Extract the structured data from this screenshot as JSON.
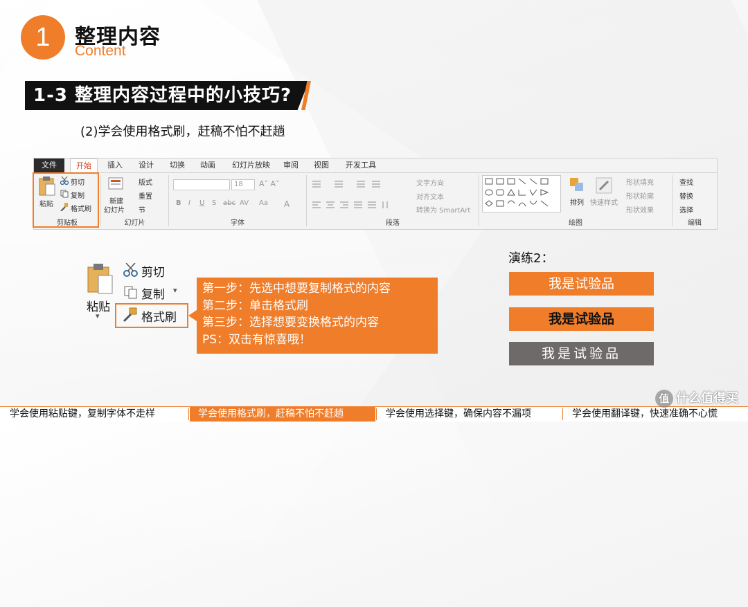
{
  "header": {
    "number": "1",
    "title": "整理内容",
    "subtitle": "Content"
  },
  "section": {
    "title": "1-3  整理内容过程中的小技巧?",
    "subheading": "(2)学会使用格式刷，赶稿不怕不赶趟"
  },
  "ribbon": {
    "tabs": [
      "文件",
      "开始",
      "插入",
      "设计",
      "切换",
      "动画",
      "幻灯片放映",
      "审阅",
      "视图",
      "开发工具"
    ],
    "clipboard": {
      "paste": "粘贴",
      "cut": "剪切",
      "copy": "复制",
      "format_painter": "格式刷",
      "label": "剪贴板"
    },
    "slides": {
      "new_slide": "新建",
      "new_slide2": "幻灯片",
      "layout": "版式",
      "reset": "重置",
      "section": "节",
      "label": "幻灯片"
    },
    "font": {
      "size": "18",
      "label": "字体",
      "buttons": [
        "B",
        "I",
        "U",
        "S",
        "abc",
        "AV",
        "Aa",
        "A"
      ]
    },
    "paragraph": {
      "text_direction": "文字方向",
      "align_text": "对齐文本",
      "convert_smartart": "转换为 SmartArt",
      "label": "段落"
    },
    "drawing": {
      "arrange": "排列",
      "quick_styles": "快速样式",
      "shape_fill": "形状填充",
      "shape_outline": "形状轮廓",
      "shape_effects": "形状效果",
      "label": "绘图"
    },
    "editing": {
      "find": "查找",
      "replace": "替换",
      "select": "选择",
      "label": "编辑"
    }
  },
  "zoom_panel": {
    "paste": "粘贴",
    "cut": "剪切",
    "copy": "复制",
    "format_painter": "格式刷"
  },
  "callout": {
    "lines": [
      "第一步：先选中想要复制格式的内容",
      "第二步：单击格式刷",
      "第三步：选择想要变换格式的内容",
      "PS：双击有惊喜哦！"
    ]
  },
  "practice": {
    "label": "演练2：",
    "items": [
      "我是试验品",
      "我是试验品",
      "我是试验品"
    ]
  },
  "footer": {
    "items": [
      "学会使用粘贴键，复制字体不走样",
      "学会使用格式刷，赶稿不怕不赶趟",
      "学会使用选择键，确保内容不漏项",
      "学会使用翻译键，快速准确不心慌"
    ],
    "active_index": 1
  },
  "watermark": {
    "badge": "值",
    "text": "什么值得买"
  },
  "colors": {
    "accent": "#ef7d2a",
    "dark": "#111111",
    "gray_box": "#6e6a69"
  }
}
